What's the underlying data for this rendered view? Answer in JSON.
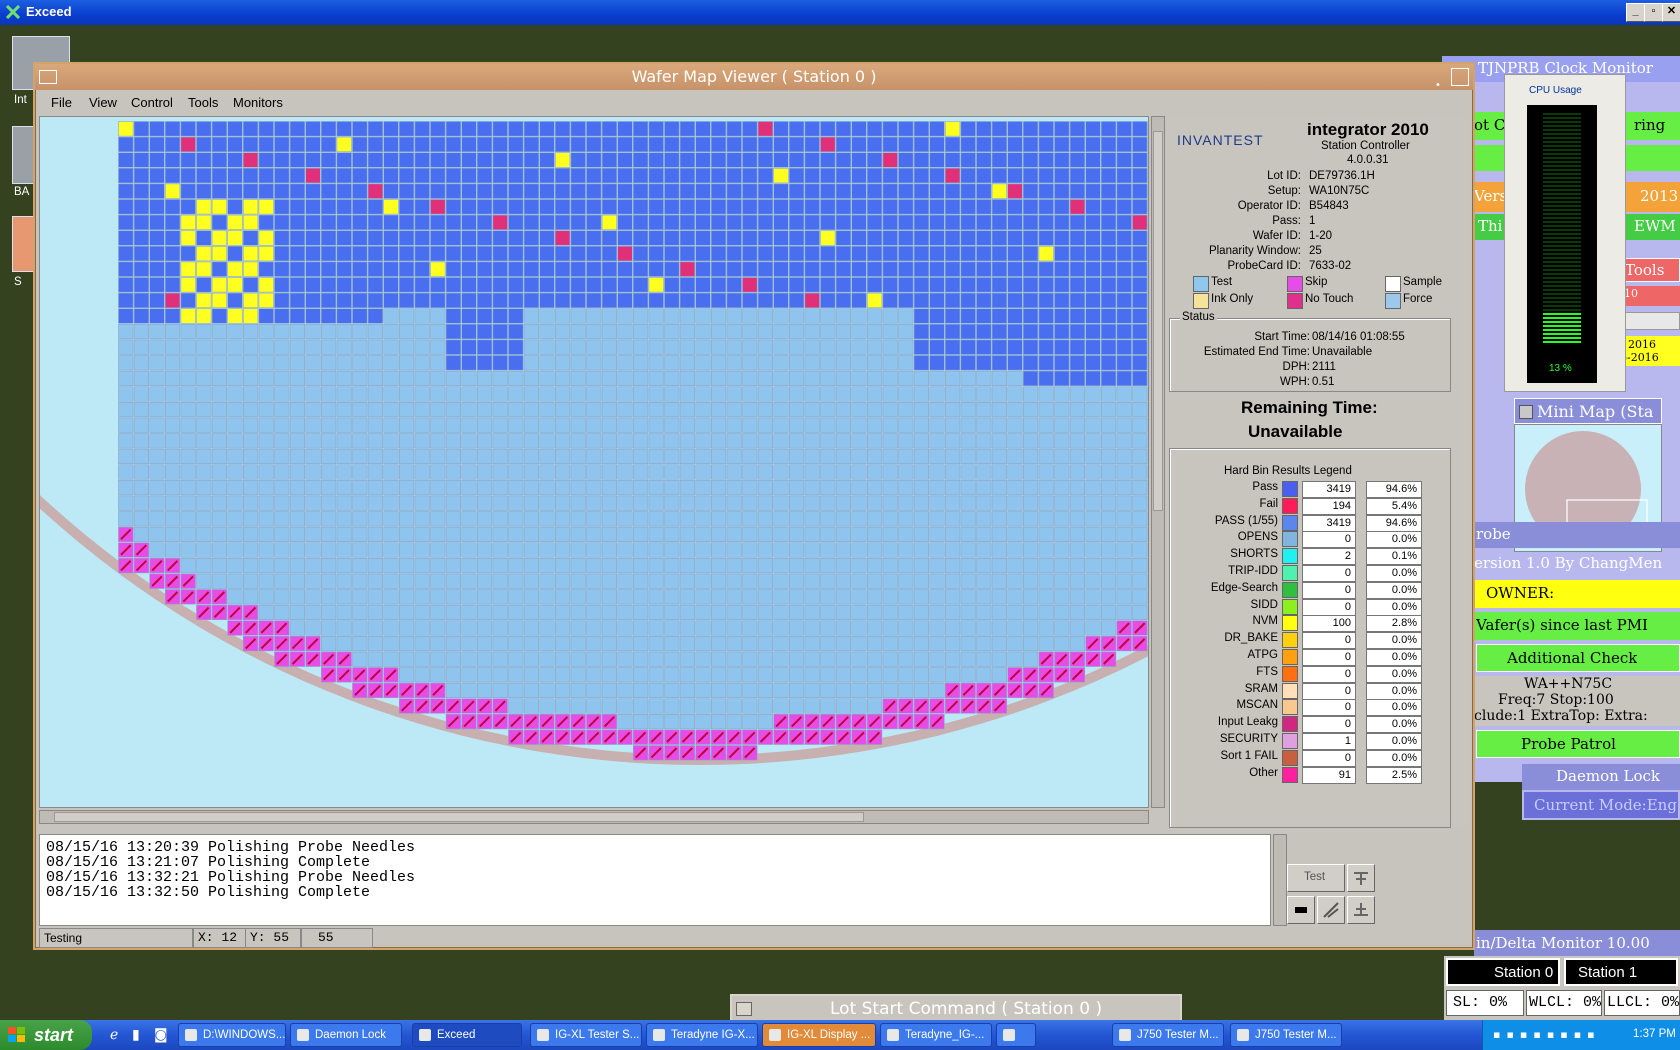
{
  "outer_window": {
    "title": "Exceed"
  },
  "desktop_icons": [
    {
      "label": "Int"
    },
    {
      "label": "BA"
    },
    {
      "label": "S"
    }
  ],
  "wafer_window": {
    "title": "Wafer Map Viewer ( Station 0 )",
    "menu": [
      "File",
      "View",
      "Control",
      "Tools",
      "Monitors"
    ]
  },
  "info": {
    "brand": "INVANTEST",
    "product": "integrator 2010",
    "subtitle": "Station Controller",
    "version": "4.0.0.31",
    "fields": [
      {
        "label": "Lot ID:",
        "value": "DE79736.1H"
      },
      {
        "label": "Setup:",
        "value": "WA10N75C"
      },
      {
        "label": "Operator ID:",
        "value": "B54843"
      },
      {
        "label": "Pass:",
        "value": "1"
      },
      {
        "label": "Wafer ID:",
        "value": "1-20"
      },
      {
        "label": "Planarity Window:",
        "value": "25"
      },
      {
        "label": "ProbeCard ID:",
        "value": "7633-02"
      }
    ],
    "legend_top": [
      {
        "label": "Test",
        "color": "#8fc8ef"
      },
      {
        "label": "Skip",
        "color": "#e64de6"
      },
      {
        "label": "Sample",
        "color": "#ffffff"
      },
      {
        "label": "Ink Only",
        "color": "#f6e39a"
      },
      {
        "label": "No Touch",
        "color": "#e0308c"
      },
      {
        "label": "Force",
        "color": "#9cc8ee"
      }
    ],
    "status_title": "Status",
    "status": [
      {
        "label": "Start Time:",
        "value": "08/14/16 01:08:55"
      },
      {
        "label": "Estimated End Time:",
        "value": "Unavailable"
      },
      {
        "label": "DPH:",
        "value": "2111"
      },
      {
        "label": "WPH:",
        "value": "0.51"
      }
    ],
    "remaining_label": "Remaining Time:",
    "remaining_value": "Unavailable",
    "hardbin_title": "Hard Bin Results Legend",
    "bins": [
      {
        "name": "Pass",
        "color": "#4a5ef0",
        "count": "3419",
        "pct": "94.6%"
      },
      {
        "name": "Fail",
        "color": "#ff1a5a",
        "count": "194",
        "pct": "5.4%"
      },
      {
        "name": "PASS (1/55)",
        "color": "#5a86ee",
        "count": "3419",
        "pct": "94.6%"
      },
      {
        "name": "OPENS",
        "color": "#7fb6e0",
        "count": "0",
        "pct": "0.0%"
      },
      {
        "name": "SHORTS",
        "color": "#21f0f0",
        "count": "2",
        "pct": "0.1%"
      },
      {
        "name": "TRIP-IDD",
        "color": "#50f0b0",
        "count": "0",
        "pct": "0.0%"
      },
      {
        "name": "Edge-Search",
        "color": "#30c040",
        "count": "0",
        "pct": "0.0%"
      },
      {
        "name": "SIDD",
        "color": "#8cf020",
        "count": "0",
        "pct": "0.0%"
      },
      {
        "name": "NVM",
        "color": "#ffff10",
        "count": "100",
        "pct": "2.8%"
      },
      {
        "name": "DR_BAKE",
        "color": "#ffd010",
        "count": "0",
        "pct": "0.0%"
      },
      {
        "name": "ATPG",
        "color": "#ffa010",
        "count": "0",
        "pct": "0.0%"
      },
      {
        "name": "FTS",
        "color": "#ff7010",
        "count": "0",
        "pct": "0.0%"
      },
      {
        "name": "SRAM",
        "color": "#ffe0b8",
        "count": "0",
        "pct": "0.0%"
      },
      {
        "name": "MSCAN",
        "color": "#f8c890",
        "count": "0",
        "pct": "0.0%"
      },
      {
        "name": "Input Leakg",
        "color": "#d02880",
        "count": "0",
        "pct": "0.0%"
      },
      {
        "name": "SECURITY",
        "color": "#e0a0e0",
        "count": "1",
        "pct": "0.0%"
      },
      {
        "name": "Sort 1 FAIL",
        "color": "#c86040",
        "count": "0",
        "pct": "0.0%"
      },
      {
        "name": "Other",
        "color": "#ff20a0",
        "count": "91",
        "pct": "2.5%"
      }
    ]
  },
  "log": [
    "08/15/16 13:20:39 Polishing Probe Needles",
    "08/15/16 13:21:07 Polishing Complete",
    "08/15/16 13:32:21 Polishing Probe Needles",
    "08/15/16 13:32:50 Polishing Complete"
  ],
  "status_bar": {
    "state": "Testing",
    "x": "X: 12",
    "y": "Y: 55",
    "bin": "55"
  },
  "test_button": "Test",
  "right_windows": {
    "clock_monitor": "TJNPRB Clock Monitor",
    "cpu_title": "CPU Usage",
    "cpu_pct": "13 %",
    "cpu_level": 0.13,
    "partial_rows": [
      "ot C",
      "ring",
      "Vers",
      "2013",
      "Thi",
      "EWM",
      "Tools",
      "10",
      "2016",
      "6-2016"
    ],
    "mini_map": "Mini Map (Sta",
    "probe": "robe",
    "version_line": "ersion 1.0 By ChangMen",
    "owner": "OWNER:",
    "pmi": "Vafer(s) since last PMI",
    "additional": "Additional Check",
    "setup_line": "WA++N75C",
    "freq_line": "Freq:7 Stop:100",
    "extra_line": "clude:1 ExtraTop: Extra:",
    "probe_patrol": "Probe Patrol",
    "daemon_lock": "Daemon Lock",
    "current_mode": "Current Mode:Eng",
    "delta_monitor": "in/Delta Monitor 10.00",
    "station0": "Station 0",
    "station1": "Station 1",
    "sl": "SL: 0%",
    "wlcl": "WLCL: 0%",
    "llcl": "LLCL: 0%"
  },
  "lot_start": "Lot Start Command ( Station 0 )",
  "taskbar": {
    "start": "start",
    "items": [
      "D:\\WINDOWS...",
      "Daemon Lock",
      "Exceed",
      "IG-XL Tester S...",
      "Teradyne IG-X...",
      "IG-XL Display ...",
      "Teradyne_IG-...",
      "",
      "J750 Tester M...",
      "J750 Tester M..."
    ],
    "clock": "1:37 PM"
  },
  "colors": {
    "pass_die": "#4a6ef0",
    "untested_die": "#8fc4ee",
    "skip_die": "#e64de6",
    "nvm_die": "#ffff20",
    "fail_die": "#e0307a",
    "wafer_edge": "#c9b0b0",
    "background": "#bde9f6"
  }
}
